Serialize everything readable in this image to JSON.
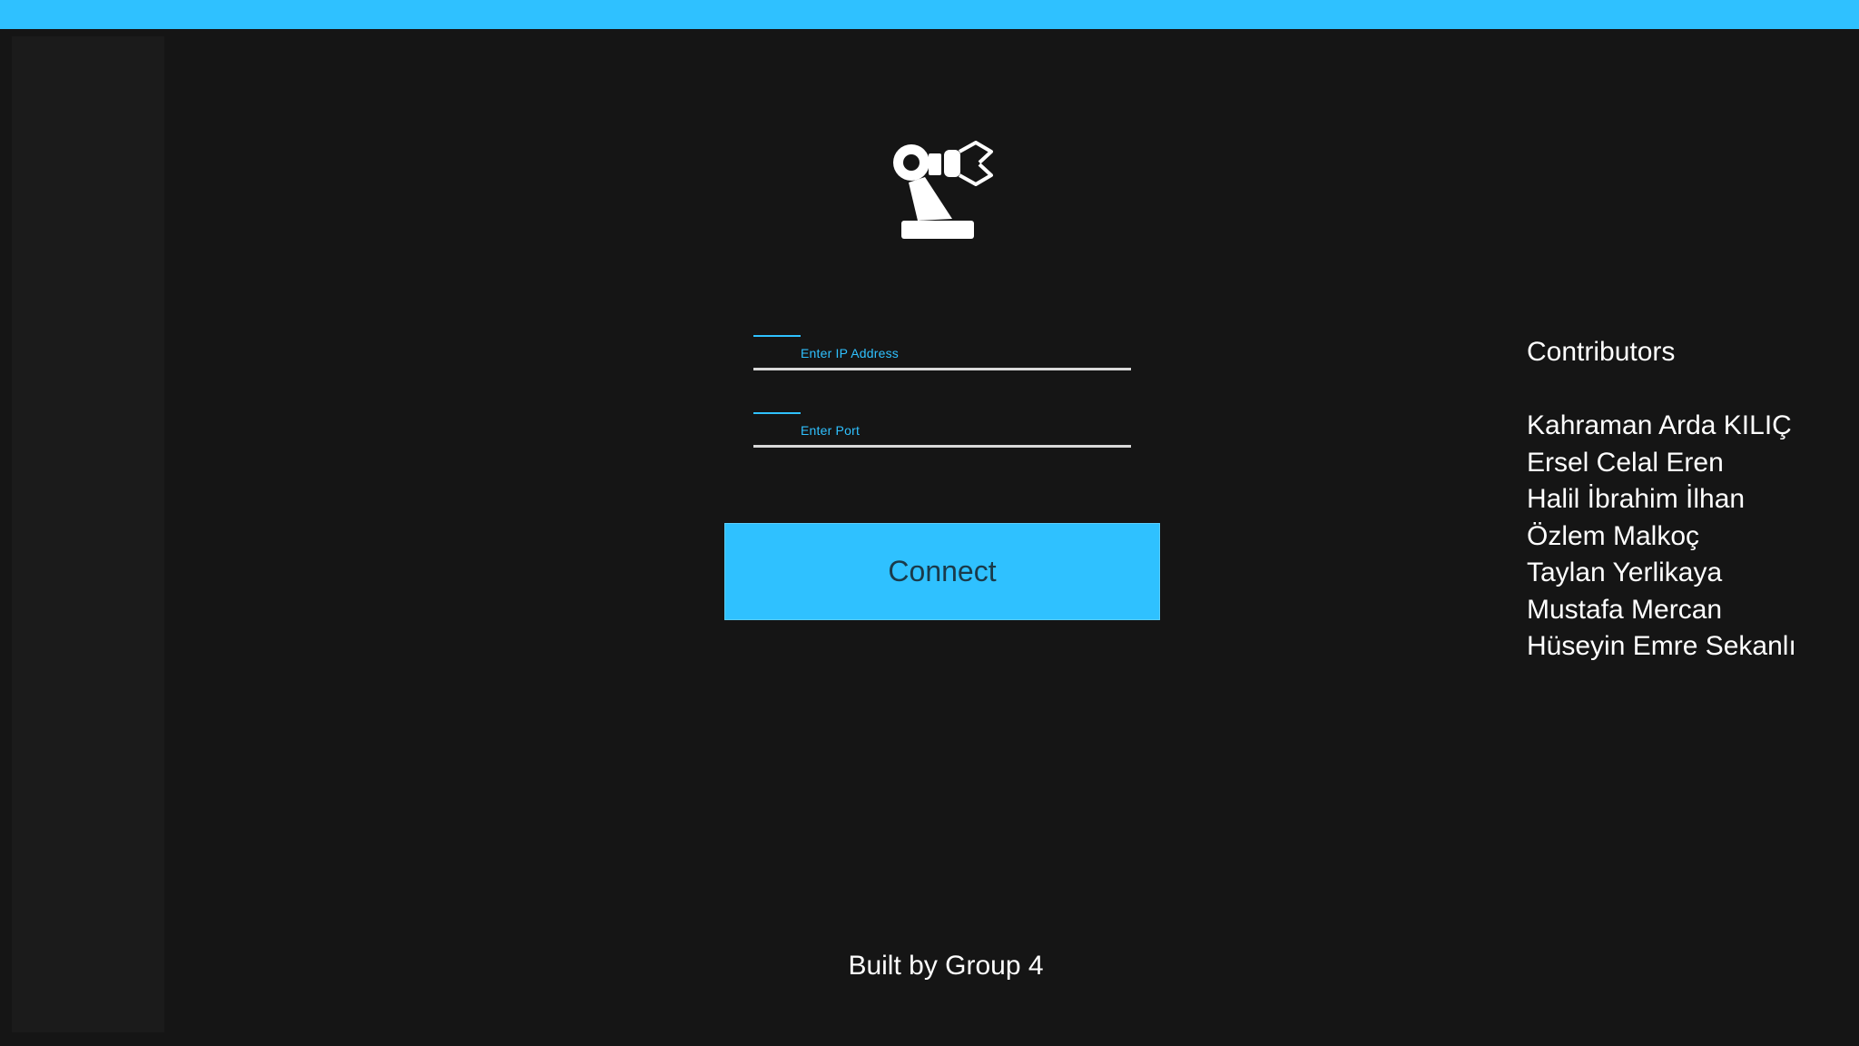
{
  "app": {
    "colors": {
      "accent": "#2fc1ff",
      "background": "#151515",
      "sidebar": "#1b1b1b",
      "text": "#ffffff"
    }
  },
  "logo": {
    "icon": "robot-arm-icon"
  },
  "form": {
    "ip_label": "Enter IP Address",
    "port_label": "Enter Port",
    "connect_label": "Connect"
  },
  "contributors": {
    "heading": "Contributors",
    "names": [
      "Kahraman Arda KILIÇ",
      "Ersel Celal Eren",
      "Halil İbrahim İlhan",
      "Özlem Malkoç",
      "Taylan Yerlikaya",
      "Mustafa Mercan",
      "Hüseyin Emre Sekanlı"
    ]
  },
  "footer": {
    "text": "Built by Group 4"
  }
}
